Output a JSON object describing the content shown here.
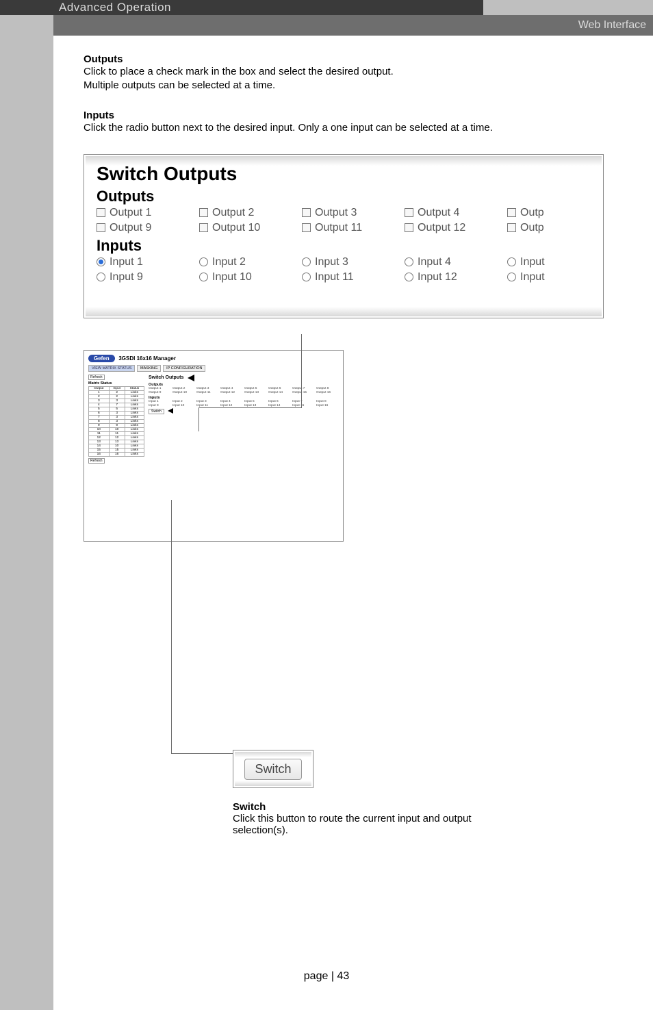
{
  "header": {
    "title": "Advanced Operation",
    "sub": "Web Interface"
  },
  "sections": {
    "outputs_h": "Outputs",
    "outputs_p1": "Click to place a check mark in the box and select the desired output.",
    "outputs_p2": "Multiple outputs can be selected at a time.",
    "inputs_h": "Inputs",
    "inputs_p": "Click the radio button next to the desired input.  Only a one input can be selected at a time."
  },
  "panel": {
    "title": "Switch Outputs",
    "outputs_h": "Outputs",
    "inputs_h": "Inputs",
    "out_row1": [
      "Output 1",
      "Output 2",
      "Output 3",
      "Output 4",
      "Outp"
    ],
    "out_row2": [
      "Output 9",
      "Output 10",
      "Output 11",
      "Output 12",
      "Outp"
    ],
    "in_row1": [
      "Input 1",
      "Input 2",
      "Input 3",
      "Input 4",
      "Input"
    ],
    "in_row2": [
      "Input 9",
      "Input 10",
      "Input 11",
      "Input 12",
      "Input"
    ]
  },
  "manager": {
    "logo": "Gefen",
    "title": "3GSDI 16x16 Manager",
    "tabs": [
      "VIEW MATRIX STATUS",
      "MASKING",
      "IP CONFIGURATION"
    ],
    "refresh": "Refresh",
    "left_head": "Matrix Status",
    "table_head": [
      "Output",
      "Input",
      "Status"
    ],
    "rows": [
      [
        "1",
        "2",
        "Links"
      ],
      [
        "2",
        "2",
        "Links"
      ],
      [
        "3",
        "3",
        "Links"
      ],
      [
        "4",
        "7",
        "Links"
      ],
      [
        "5",
        "5",
        "Links"
      ],
      [
        "6",
        "3",
        "Links"
      ],
      [
        "7",
        "3",
        "Links"
      ],
      [
        "8",
        "3",
        "Links"
      ],
      [
        "9",
        "9",
        "Links"
      ],
      [
        "10",
        "10",
        "Links"
      ],
      [
        "11",
        "11",
        "Links"
      ],
      [
        "12",
        "12",
        "Links"
      ],
      [
        "13",
        "13",
        "Links"
      ],
      [
        "14",
        "10",
        "Links"
      ],
      [
        "15",
        "15",
        "Links"
      ],
      [
        "16",
        "16",
        "Links"
      ]
    ],
    "right_head": "Switch Outputs",
    "right_out_h": "Outputs",
    "right_in_h": "Inputs",
    "out_labels_a": [
      "Output 1",
      "Output 2",
      "Output 3",
      "Output 4",
      "Output 5",
      "Output 6",
      "Output 7",
      "Output 8"
    ],
    "out_labels_b": [
      "Output 9",
      "Output 10",
      "Output 11",
      "Output 12",
      "Output 13",
      "Output 14",
      "Output 15",
      "Output 16"
    ],
    "in_labels_a": [
      "Input 1",
      "Input 2",
      "Input 3",
      "Input 4",
      "Input 5",
      "Input 6",
      "Input 7",
      "Input 8"
    ],
    "in_labels_b": [
      "Input 9",
      "Input 10",
      "Input 11",
      "Input 12",
      "Input 13",
      "Input 14",
      "Input 15",
      "Input 16"
    ],
    "switch_btn": "Switch"
  },
  "switch_box": {
    "btn": "Switch",
    "cap_h": "Switch",
    "cap_p": "Click this button to route the current input and output selection(s)."
  },
  "page_num": "page | 43"
}
